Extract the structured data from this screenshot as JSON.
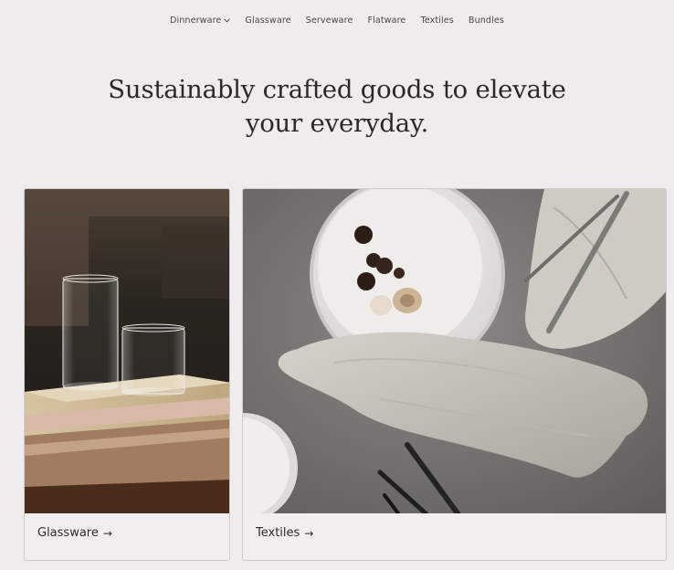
{
  "nav": {
    "items": [
      {
        "label": "Dinnerware",
        "has_dropdown": true
      },
      {
        "label": "Glassware"
      },
      {
        "label": "Serveware"
      },
      {
        "label": "Flatware"
      },
      {
        "label": "Textiles"
      },
      {
        "label": "Bundles"
      }
    ]
  },
  "hero": {
    "line1": "Sustainably crafted goods to elevate",
    "line2": "your everyday."
  },
  "cards": [
    {
      "label": "Glassware",
      "arrow": "→",
      "image": "glasses-on-books-photo"
    },
    {
      "label": "Textiles",
      "arrow": "→",
      "image": "linen-napkin-and-plates-photo"
    }
  ],
  "colors": {
    "background": "#eeecec",
    "text": "#2c2b2a",
    "card_border": "#cfcdcc"
  }
}
